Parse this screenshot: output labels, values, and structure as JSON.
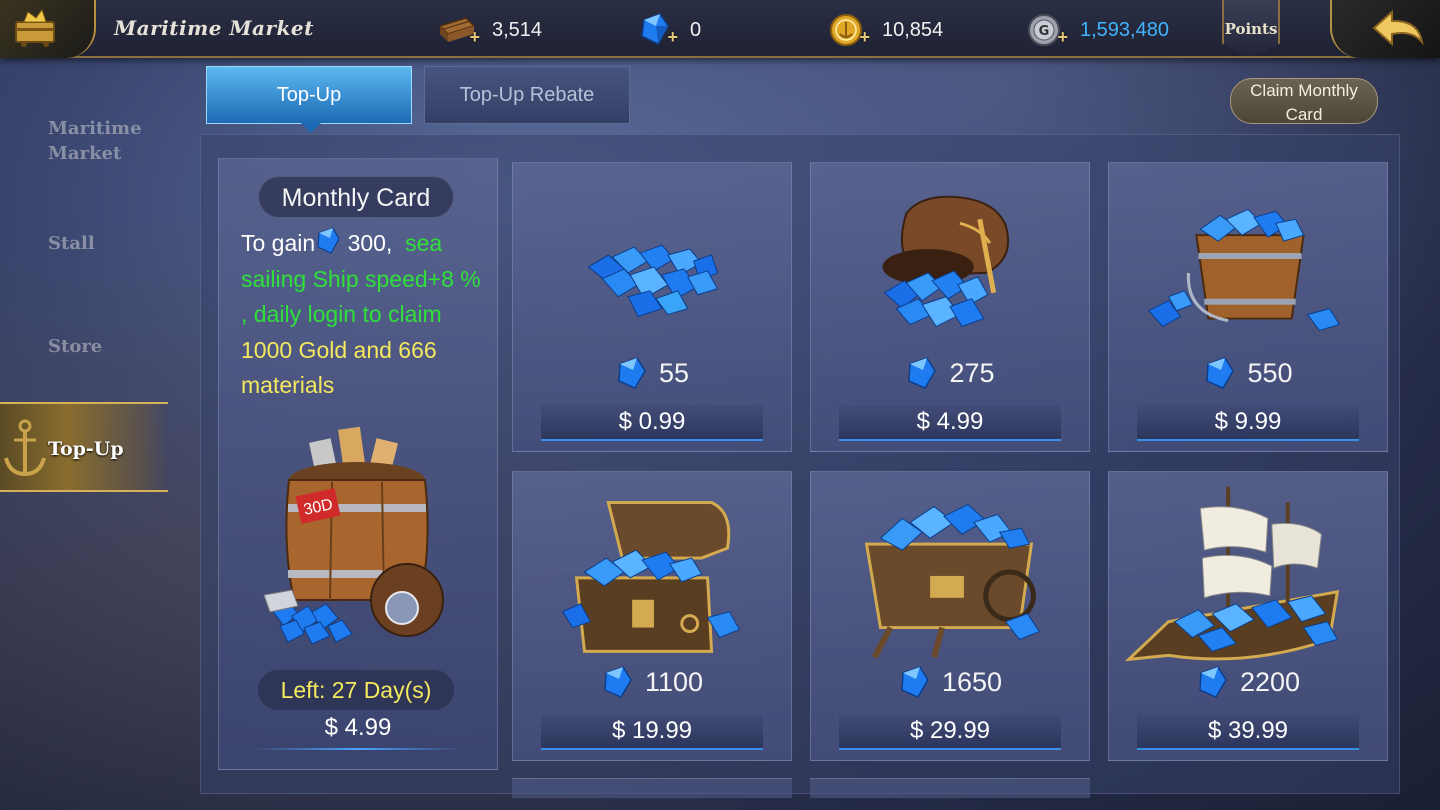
{
  "header": {
    "title": "Maritime Market",
    "resources": [
      {
        "icon": "wood-planks-icon",
        "value": "3,514"
      },
      {
        "icon": "blue-gem-icon",
        "value": "0"
      },
      {
        "icon": "gold-coin-icon",
        "value": "10,854"
      },
      {
        "icon": "silver-coin-icon",
        "value": "1,593,480",
        "color": "#3fb4ff"
      }
    ],
    "points_label": "Points"
  },
  "sidenav": {
    "items": [
      {
        "label": "Maritime\nMarket"
      },
      {
        "label": "Stall"
      },
      {
        "label": "Store"
      },
      {
        "label": "Top-Up",
        "active": true
      }
    ]
  },
  "tabs": [
    {
      "label": "Top-Up",
      "active": true
    },
    {
      "label": "Top-Up Rebate",
      "active": false
    }
  ],
  "claim_button": "Claim Monthly Card",
  "monthly_card": {
    "title": "Monthly Card",
    "desc_prefix": "To gain",
    "desc_amount": "300,",
    "desc_green": "sea sailing Ship speed+8 % , daily login to claim",
    "desc_yellow": "1000 Gold",
    "desc_and": "and",
    "desc_yellow2": "666 materials",
    "badge": "30D",
    "left": "Left: 27 Day(s)",
    "price": "$ 4.99"
  },
  "packages": [
    {
      "gems": "55",
      "price": "$ 0.99",
      "art": "gem-pile"
    },
    {
      "gems": "275",
      "price": "$ 4.99",
      "art": "gem-sack"
    },
    {
      "gems": "550",
      "price": "$ 9.99",
      "art": "gem-bucket"
    },
    {
      "gems": "1100",
      "price": "$ 19.99",
      "art": "gem-chest"
    },
    {
      "gems": "1650",
      "price": "$ 29.99",
      "art": "gem-cart"
    },
    {
      "gems": "2200",
      "price": "$ 39.99",
      "art": "gem-ship"
    }
  ],
  "colors": {
    "accent_gold": "#d7b15a",
    "tab_blue": "#1e6ab4",
    "green_text": "#30e03a",
    "yellow_text": "#f4e85e"
  }
}
